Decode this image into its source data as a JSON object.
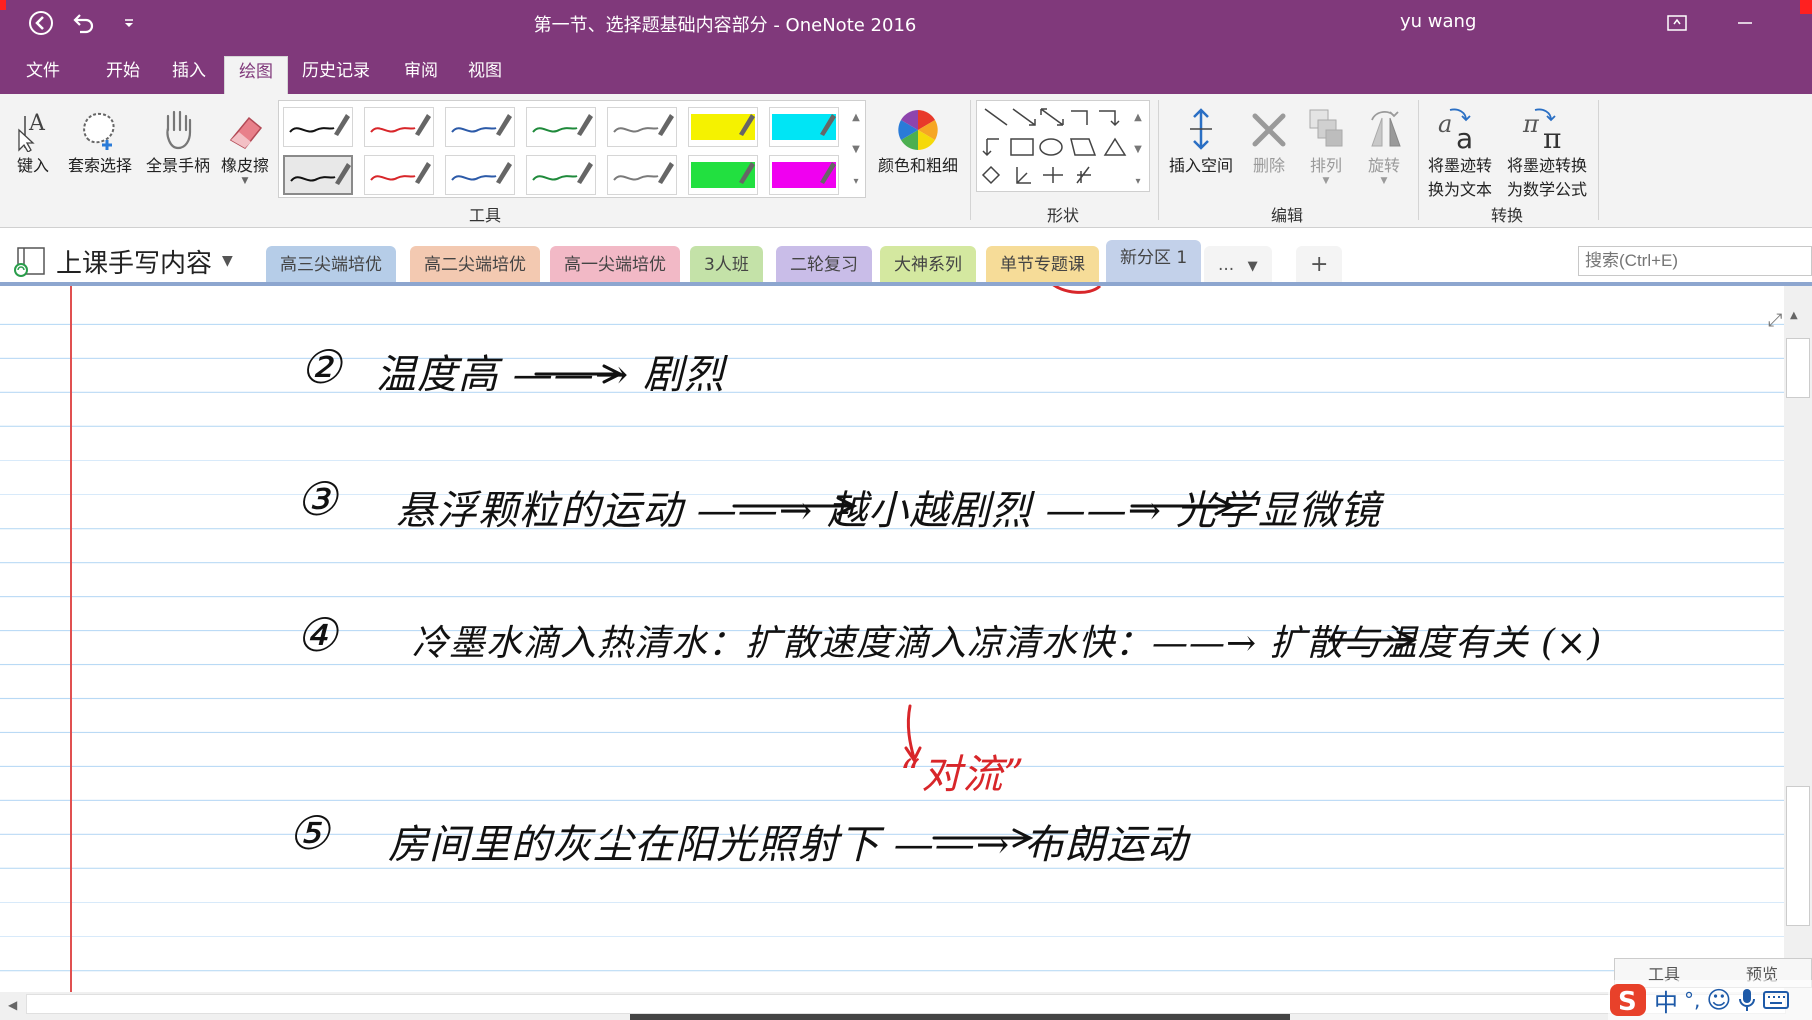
{
  "window": {
    "title": "第一节、选择题基础内容部分  -  OneNote 2016",
    "user": "yu wang"
  },
  "menu": {
    "tabs": [
      "文件",
      "开始",
      "插入",
      "绘图",
      "历史记录",
      "审阅",
      "视图"
    ],
    "active": "绘图"
  },
  "ribbon": {
    "tools": [
      "键入",
      "套索选择",
      "全景手柄",
      "橡皮擦"
    ],
    "color_weight": "颜色和粗细",
    "edit": [
      "插入空间",
      "删除",
      "排列",
      "旋转"
    ],
    "convert": [
      {
        "line1": "将墨迹转",
        "line2": "换为文本"
      },
      {
        "line1": "将墨迹转换",
        "line2": "为数学公式"
      }
    ],
    "groups": [
      "工具",
      "形状",
      "编辑",
      "转换"
    ],
    "pens": [
      {
        "color": "#111111"
      },
      {
        "color": "#d8262a"
      },
      {
        "color": "#2c5aa8"
      },
      {
        "color": "#1f8a3b"
      },
      {
        "color": "#7a7a7a"
      },
      {
        "color": "#f5f200",
        "highlighter": true
      },
      {
        "color": "#00e5f5",
        "highlighter": true
      },
      {
        "color": "#111111"
      },
      {
        "color": "#d8262a"
      },
      {
        "color": "#2c5aa8"
      },
      {
        "color": "#1f8a3b"
      },
      {
        "color": "#7a7a7a"
      },
      {
        "color": "#22e040",
        "highlighter": true
      },
      {
        "color": "#f000f0",
        "highlighter": true
      }
    ]
  },
  "notebook": {
    "name": "上课手写内容",
    "sections": [
      {
        "label": "高三尖端培优",
        "color": "#b6cde8"
      },
      {
        "label": "高二尖端培优",
        "color": "#f3c9b1"
      },
      {
        "label": "高一尖端培优",
        "color": "#f2b9c6"
      },
      {
        "label": "3人班",
        "color": "#c4e2a8"
      },
      {
        "label": "二轮复习",
        "color": "#c9bde8"
      },
      {
        "label": "大神系列",
        "color": "#d4e8a0"
      },
      {
        "label": "单节专题课",
        "color": "#f6dc98"
      },
      {
        "label": "新分区 1",
        "color": "#c3d1ea",
        "active": true
      }
    ],
    "more": "...",
    "add": "+",
    "search_placeholder": "搜索(Ctrl+E)"
  },
  "page": {
    "lines": [
      {
        "num": "②",
        "text": "温度高 ——→ 剧烈"
      },
      {
        "num": "③",
        "text": "悬浮颗粒的运动 ——→ 越小越剧烈 ——→ 光学显微镜"
      },
      {
        "num": "④",
        "text": "冷墨水滴入热清水：扩散速度滴入凉清水快：——→ 扩散与温度有关 (×)"
      },
      {
        "num": "⑤",
        "text": "房间里的灰尘在阳光照射下 ——→ 布朗运动"
      }
    ],
    "annotation": "“对流”"
  },
  "floating": {
    "left": "工具",
    "right": "预览"
  },
  "ime": {
    "lang": "中",
    "punct": "°,"
  }
}
